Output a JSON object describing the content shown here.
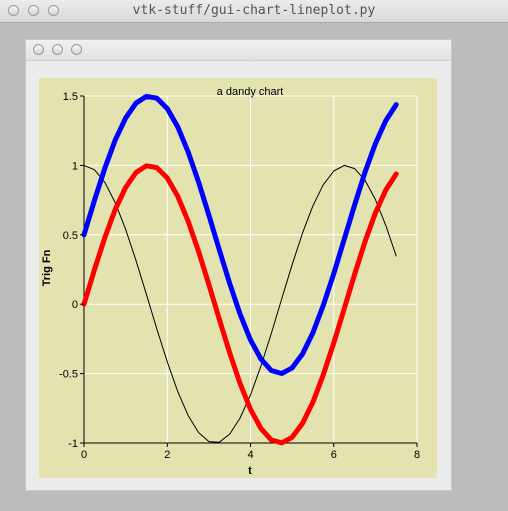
{
  "window": {
    "title": "vtk-stuff/gui-chart-lineplot.py"
  },
  "chart_data": {
    "type": "line",
    "title": "a dandy chart",
    "xlabel": "t",
    "ylabel": "Trig Fn",
    "xlim": [
      0,
      8
    ],
    "ylim": [
      -1,
      1.5
    ],
    "xticks": [
      0,
      2,
      4,
      6,
      8
    ],
    "yticks": [
      -1,
      -0.5,
      0,
      0.5,
      1,
      1.5
    ],
    "xtick_labels": [
      "0",
      "2",
      "4",
      "6",
      "8"
    ],
    "ytick_labels": [
      "-1",
      "-0.5",
      "0",
      "0.5",
      "1",
      "1.5"
    ],
    "grid": true,
    "background": "#e3e3b0",
    "series": [
      {
        "color": "#000000",
        "line_width": 1,
        "x": [
          0,
          0.25,
          0.5,
          0.75,
          1,
          1.25,
          1.5,
          1.75,
          2,
          2.25,
          2.5,
          2.75,
          3,
          3.25,
          3.5,
          3.75,
          4,
          4.25,
          4.5,
          4.75,
          5,
          5.25,
          5.5,
          5.75,
          6,
          6.25,
          6.5,
          6.75,
          7,
          7.25,
          7.5
        ],
        "y": [
          1,
          0.969,
          0.878,
          0.732,
          0.54,
          0.315,
          0.071,
          -0.178,
          -0.416,
          -0.628,
          -0.801,
          -0.924,
          -0.99,
          -0.994,
          -0.936,
          -0.82,
          -0.654,
          -0.446,
          -0.211,
          0.038,
          0.284,
          0.512,
          0.709,
          0.861,
          0.96,
          1,
          0.977,
          0.893,
          0.754,
          0.568,
          0.347
        ]
      },
      {
        "color": "#ff0000",
        "line_width": 5,
        "x": [
          0,
          0.25,
          0.5,
          0.75,
          1,
          1.25,
          1.5,
          1.75,
          2,
          2.25,
          2.5,
          2.75,
          3,
          3.25,
          3.5,
          3.75,
          4,
          4.25,
          4.5,
          4.75,
          5,
          5.25,
          5.5,
          5.75,
          6,
          6.25,
          6.5,
          6.75,
          7,
          7.25,
          7.5
        ],
        "y": [
          0,
          0.247,
          0.479,
          0.682,
          0.841,
          0.949,
          0.997,
          0.984,
          0.909,
          0.778,
          0.598,
          0.382,
          0.141,
          -0.108,
          -0.351,
          -0.572,
          -0.757,
          -0.895,
          -0.978,
          -0.999,
          -0.959,
          -0.859,
          -0.706,
          -0.508,
          -0.279,
          -0.033,
          0.215,
          0.451,
          0.657,
          0.823,
          0.938
        ]
      },
      {
        "color": "#0000ff",
        "line_width": 5,
        "x": [
          0,
          0.25,
          0.5,
          0.75,
          1,
          1.25,
          1.5,
          1.75,
          2,
          2.25,
          2.5,
          2.75,
          3,
          3.25,
          3.5,
          3.75,
          4,
          4.25,
          4.5,
          4.75,
          5,
          5.25,
          5.5,
          5.75,
          6,
          6.25,
          6.5,
          6.75,
          7,
          7.25,
          7.5
        ],
        "y": [
          0.5,
          0.747,
          0.979,
          1.182,
          1.341,
          1.449,
          1.497,
          1.484,
          1.409,
          1.278,
          1.098,
          0.882,
          0.641,
          0.392,
          0.149,
          -0.072,
          -0.257,
          -0.395,
          -0.478,
          -0.499,
          -0.459,
          -0.359,
          -0.206,
          -0.008,
          0.221,
          0.467,
          0.715,
          0.951,
          1.157,
          1.323,
          1.438
        ]
      }
    ]
  }
}
